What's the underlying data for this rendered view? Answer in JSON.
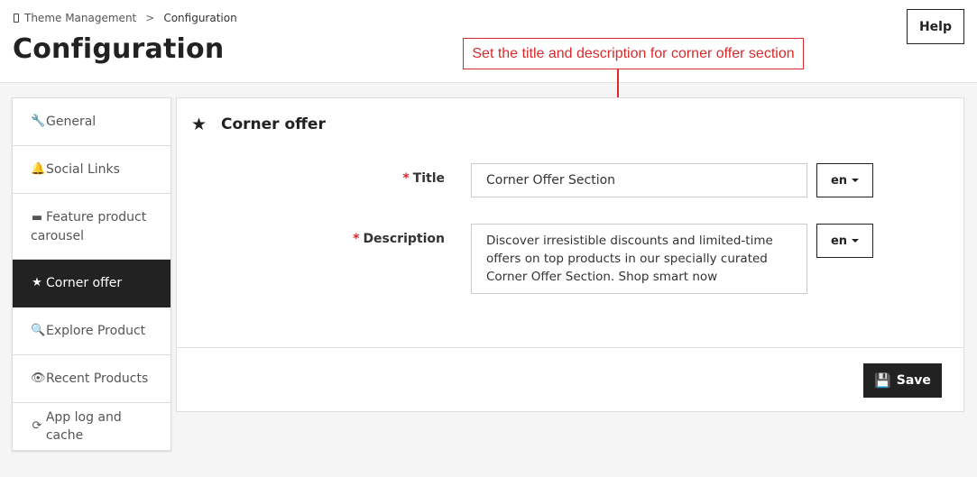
{
  "breadcrumb": {
    "parent": "Theme Management",
    "separator": ">",
    "current": "Configuration"
  },
  "header": {
    "title": "Configuration",
    "help_label": "Help"
  },
  "annotation": {
    "text": "Set the title and description for corner offer section"
  },
  "sidebar": {
    "items": [
      {
        "label": "General",
        "icon": "wrench-icon",
        "glyph": "🔧",
        "active": false
      },
      {
        "label": "Social Links",
        "icon": "bell-icon",
        "glyph": "🔔",
        "active": false
      },
      {
        "label": "Feature product carousel",
        "icon": "archive-icon",
        "glyph": "▬",
        "active": false
      },
      {
        "label": "Corner offer",
        "icon": "star-icon",
        "glyph": "★",
        "active": true
      },
      {
        "label": "Explore Product",
        "icon": "search-icon",
        "glyph": "🔍",
        "active": false
      },
      {
        "label": "Recent Products",
        "icon": "eye-icon",
        "glyph": "👁",
        "active": false
      },
      {
        "label": "App log and cache",
        "icon": "refresh-icon",
        "glyph": "⟳",
        "active": false
      }
    ]
  },
  "panel": {
    "title": "Corner offer",
    "icon": "star-icon",
    "glyph": "★",
    "fields": {
      "title": {
        "required_mark": "*",
        "label": "Title",
        "value": "Corner Offer Section",
        "lang": "en"
      },
      "description": {
        "required_mark": "*",
        "label": "Description",
        "value": "Discover irresistible discounts and limited-time offers on top products in our specially curated Corner Offer Section. Shop smart now",
        "lang": "en"
      }
    },
    "save_label": "Save"
  },
  "colors": {
    "accent_dark": "#222222",
    "annotation_red": "#d62b2b",
    "required_red": "#d62b2b"
  }
}
